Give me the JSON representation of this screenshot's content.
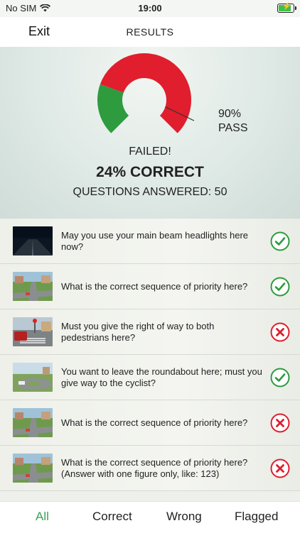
{
  "status_bar": {
    "carrier": "No SIM",
    "time": "19:00"
  },
  "nav": {
    "exit_label": "Exit",
    "title": "RESULTS"
  },
  "summary": {
    "score_fraction": 0.24,
    "pass_threshold_fraction": 0.9,
    "pass_label_line1": "90%",
    "pass_label_line2": "PASS",
    "status_text": "FAILED!",
    "correct_text": "24% CORRECT",
    "answered_text": "QUESTIONS ANSWERED: 50",
    "colors": {
      "correct": "#2e9b3f",
      "wrong": "#e01e2d"
    }
  },
  "questions": [
    {
      "text": "May you use your main beam headlights here now?",
      "result": "correct",
      "thumb": "night-road-image"
    },
    {
      "text": "What is the correct sequence of priority here?",
      "result": "correct",
      "thumb": "junction-image"
    },
    {
      "text": "Must you give the right of way to both pedestrians here?",
      "result": "wrong",
      "thumb": "pedestrian-crossing-image"
    },
    {
      "text": "You want to leave the roundabout here; must you give way to the cyclist?",
      "result": "correct",
      "thumb": "roundabout-image"
    },
    {
      "text": "What is the correct sequence of priority here?",
      "result": "wrong",
      "thumb": "junction-image"
    },
    {
      "text": "What is the correct sequence of priority here? (Answer with one figure only, like: 123)",
      "result": "wrong",
      "thumb": "junction-image"
    }
  ],
  "tabs": [
    {
      "label": "All",
      "active": true
    },
    {
      "label": "Correct",
      "active": false
    },
    {
      "label": "Wrong",
      "active": false
    },
    {
      "label": "Flagged",
      "active": false
    }
  ]
}
